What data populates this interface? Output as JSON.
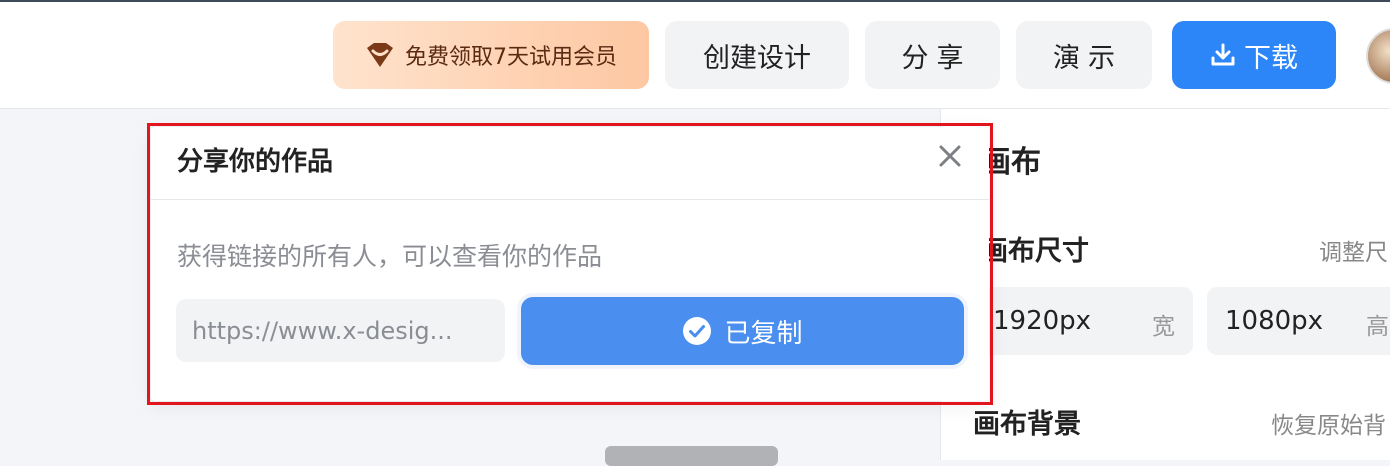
{
  "header": {
    "vip_label": "免费领取7天试用会员",
    "create_label": "创建设计",
    "share_label": "分享",
    "present_label": "演示",
    "download_label": "下载",
    "colors": {
      "download": "#2c86f7",
      "vip_text": "#5a2a12"
    }
  },
  "dialog": {
    "title": "分享你的作品",
    "description": "获得链接的所有人，可以查看你的作品",
    "link_value": "https://www.x-desig...",
    "copied_label": "已复制",
    "icons": {
      "close": "close-icon",
      "copied": "check-circle-icon"
    }
  },
  "right_panel": {
    "title": "画布",
    "size_label": "画布尺寸",
    "resize_label": "调整尺",
    "width_value": "1920px",
    "width_unit": "宽",
    "height_value": "1080px",
    "height_unit": "高",
    "background_label": "画布背景",
    "restore_label": "恢复原始背"
  }
}
